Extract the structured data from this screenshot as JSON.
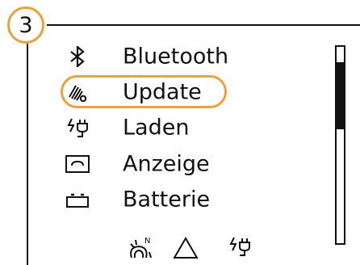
{
  "step": {
    "number": "3",
    "color": "#e8a33a"
  },
  "menu": {
    "selected_index": 1,
    "items": [
      {
        "label": "Bluetooth",
        "icon": "bluetooth-icon"
      },
      {
        "label": "Update",
        "icon": "wireless-update-icon"
      },
      {
        "label": "Laden",
        "icon": "charging-plug-icon"
      },
      {
        "label": "Anzeige",
        "icon": "display-icon"
      },
      {
        "label": "Batterie",
        "icon": "battery-icon"
      }
    ]
  },
  "scrollbar": {
    "thumb_start_fraction": 0.08,
    "thumb_end_fraction": 0.42
  },
  "status_icons": [
    "tire-pressure-icon",
    "warning-triangle-icon",
    "charging-plug-icon"
  ]
}
